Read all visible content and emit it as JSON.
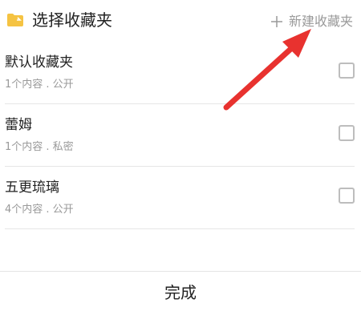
{
  "header": {
    "title": "选择收藏夹",
    "new_folder_label": "新建收藏夹"
  },
  "folders": [
    {
      "name": "默认收藏夹",
      "meta": "1个内容 . 公开",
      "checked": false
    },
    {
      "name": "蕾姆",
      "meta": "1个内容 . 私密",
      "checked": false
    },
    {
      "name": "五更琉璃",
      "meta": "4个内容 . 公开",
      "checked": false
    }
  ],
  "footer": {
    "done_label": "完成"
  },
  "colors": {
    "folder_icon": "#f5c342",
    "annotation_arrow": "#e8322f"
  }
}
